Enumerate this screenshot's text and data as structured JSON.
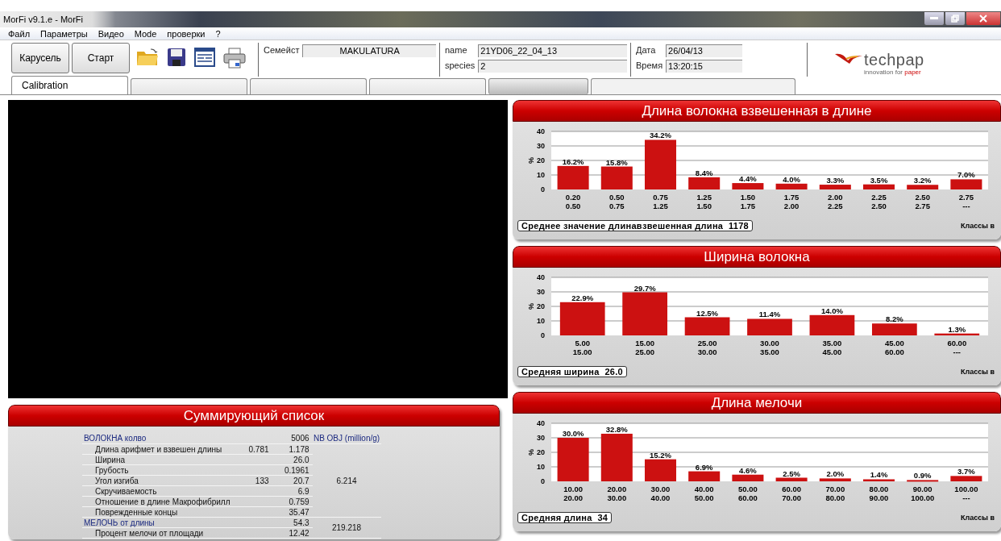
{
  "window": {
    "title": "MorFi v9.1.e - MorFi"
  },
  "menu": [
    "Файл",
    "Параметры",
    "Видео",
    "Mode",
    "проверки",
    "?"
  ],
  "toolbar": {
    "buttons": [
      "Карусель",
      "Старт"
    ],
    "family": {
      "label": "Семейст",
      "value": "MAKULATURA"
    },
    "name": {
      "label": "name",
      "value": "21YD06_22_04_13"
    },
    "species": {
      "label": "species",
      "value": "2"
    },
    "date": {
      "label": "Дата",
      "value": "26/04/13"
    },
    "time": {
      "label": "Время",
      "value": "13:20:15"
    },
    "logo": {
      "name": "techpap",
      "tagline": "innovation for ",
      "tagline_accent": "paper"
    }
  },
  "tabs": [
    {
      "label": "Calibration",
      "selected": true
    },
    {
      "selected": false
    },
    {
      "selected": false
    },
    {
      "selected": false
    }
  ],
  "summary": {
    "title": "Суммирующий список",
    "groups": [
      {
        "title": "ВОЛОКНА колво",
        "value": "5006",
        "nb_heading": "NB OBJ (million/g)",
        "nb_value": "6.214",
        "items": [
          {
            "label": "Длина арифмет и взвешен длины",
            "values": [
              "0.781",
              "1.178"
            ]
          },
          {
            "label": "Ширина",
            "values": [
              "26.0"
            ]
          },
          {
            "label": "Грубость",
            "values": [
              "0.1961"
            ]
          },
          {
            "label": "Угол изгиба",
            "values": [
              "133",
              "20.7"
            ]
          },
          {
            "label": "Скручиваемость",
            "values": [
              "6.9"
            ]
          },
          {
            "label": "Отношение в длине Макрофибрилл",
            "values": [
              "0.759"
            ]
          },
          {
            "label": "Поврежденные концы",
            "values": [
              "35.47"
            ]
          }
        ]
      },
      {
        "title": "МЕЛОЧЬ от длины",
        "value": "54.3",
        "nb_value": "219.218",
        "items": [
          {
            "label": "Процент мелочи от площади",
            "values": [
              "12.42"
            ]
          }
        ]
      }
    ]
  },
  "charts": [
    {
      "title": "Длина волокна взвешенная в длине",
      "mean": "Среднее значение длинавзвешенная длина  1178",
      "chart_data": {
        "type": "bar",
        "xlabel": "Классы в",
        "ylabel": "%",
        "ylim": [
          0,
          40
        ],
        "yticks": [
          0,
          10,
          20,
          30,
          40
        ],
        "categories": [
          "0.20\n0.50",
          "0.50\n0.75",
          "0.75\n1.25",
          "1.25\n1.50",
          "1.50\n1.75",
          "1.75\n2.00",
          "2.00\n2.25",
          "2.25\n2.50",
          "2.50\n2.75",
          "2.75\n---"
        ],
        "grid": true,
        "series": [
          {
            "color": "#cc1111",
            "values": [
              16.2,
              15.8,
              34.2,
              8.4,
              4.4,
              4.0,
              3.3,
              3.5,
              3.2,
              7.0
            ]
          }
        ],
        "value_labels": [
          "16.2%",
          "15.8%",
          "34.2%",
          "8.4%",
          "4.4%",
          "4.0%",
          "3.3%",
          "3.5%",
          "3.2%",
          "7.0%"
        ]
      }
    },
    {
      "title": "Ширина волокна",
      "mean": "Средняя ширина  26.0",
      "chart_data": {
        "type": "bar",
        "xlabel": "Классы в",
        "ylabel": "%",
        "ylim": [
          0,
          40
        ],
        "yticks": [
          0,
          10,
          20,
          30,
          40
        ],
        "categories": [
          "5.00\n15.00",
          "15.00\n25.00",
          "25.00\n30.00",
          "30.00\n35.00",
          "35.00\n45.00",
          "45.00\n60.00",
          "60.00\n---"
        ],
        "grid": true,
        "series": [
          {
            "color": "#cc1111",
            "values": [
              22.9,
              29.7,
              12.5,
              11.4,
              14.0,
              8.2,
              1.3
            ]
          }
        ],
        "value_labels": [
          "22.9%",
          "29.7%",
          "12.5%",
          "11.4%",
          "14.0%",
          "8.2%",
          "1.3%"
        ]
      }
    },
    {
      "title": "Длина мелочи",
      "mean": "Средняя длина  34",
      "chart_data": {
        "type": "bar",
        "xlabel": "Классы в",
        "ylabel": "%",
        "ylim": [
          0,
          40
        ],
        "yticks": [
          0,
          10,
          20,
          30,
          40
        ],
        "categories": [
          "10.00\n20.00",
          "20.00\n30.00",
          "30.00\n40.00",
          "40.00\n50.00",
          "50.00\n60.00",
          "60.00\n70.00",
          "70.00\n80.00",
          "80.00\n90.00",
          "90.00\n100.00",
          "100.00\n---"
        ],
        "grid": true,
        "series": [
          {
            "color": "#cc1111",
            "values": [
              30.0,
              32.8,
              15.2,
              6.9,
              4.6,
              2.5,
              2.0,
              1.4,
              0.9,
              3.7
            ]
          }
        ],
        "value_labels": [
          "30.0%",
          "32.8%",
          "15.2%",
          "6.9%",
          "4.6%",
          "2.5%",
          "2.0%",
          "1.4%",
          "0.9%",
          "3.7%"
        ]
      }
    }
  ]
}
